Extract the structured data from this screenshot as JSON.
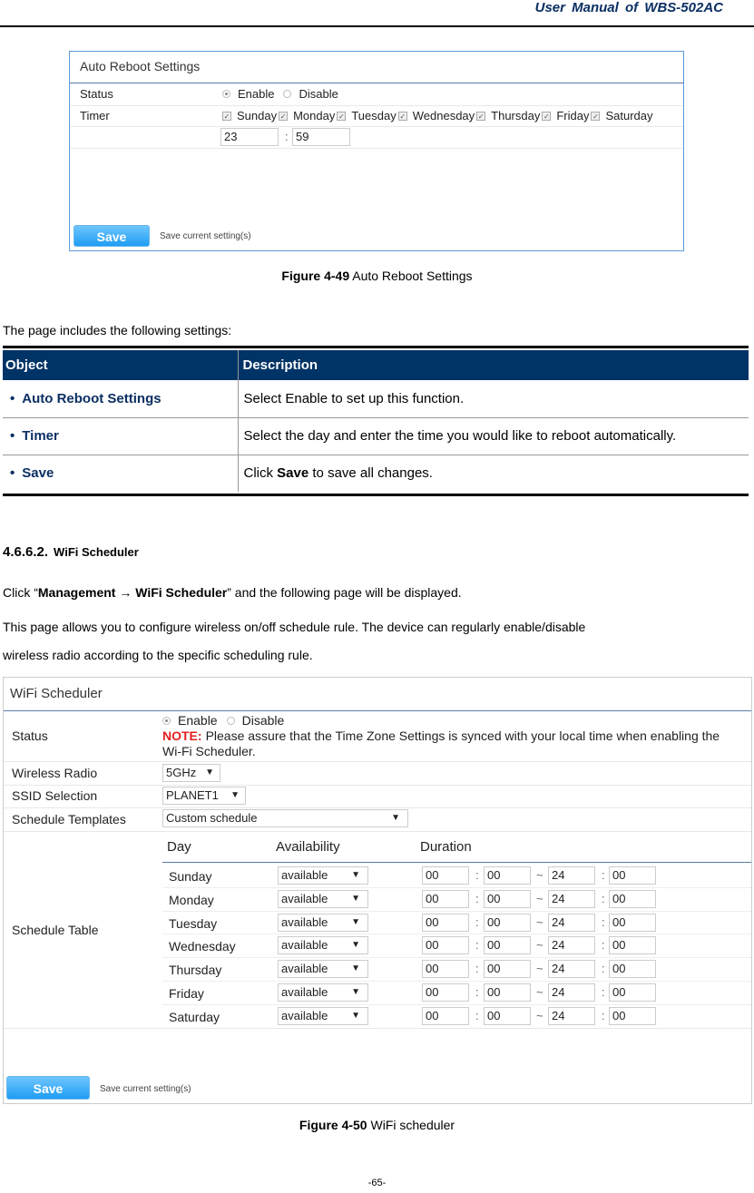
{
  "header": {
    "title": "User  Manual  of  WBS-502AC"
  },
  "auto_reboot": {
    "panel_title": "Auto Reboot Settings",
    "status_label": "Status",
    "status_options": [
      {
        "label": "Enable",
        "selected": true
      },
      {
        "label": "Disable",
        "selected": false
      }
    ],
    "timer_label": "Timer",
    "days": [
      {
        "label": "Sunday",
        "checked": true
      },
      {
        "label": "Monday",
        "checked": true
      },
      {
        "label": "Tuesday",
        "checked": true
      },
      {
        "label": "Wednesday",
        "checked": true
      },
      {
        "label": "Thursday",
        "checked": true
      },
      {
        "label": "Friday",
        "checked": true
      },
      {
        "label": "Saturday",
        "checked": true
      }
    ],
    "hour": "23",
    "minute": "59",
    "time_separator": ":",
    "save_label": "Save",
    "save_hint": "Save current setting(s)"
  },
  "figure_49": {
    "num": "Figure 4-49",
    "text": " Auto Reboot Settings"
  },
  "intro": "The page includes the following settings:",
  "desc_table": {
    "headers": [
      "Object",
      "Description"
    ],
    "rows": [
      {
        "object": "Auto Reboot Settings",
        "desc_pre": "Select Enable to set up this function.",
        "desc_bold": "",
        "desc_post": ""
      },
      {
        "object": "Timer",
        "desc_pre": "Select the day and enter the time you would like to reboot automatically.",
        "desc_bold": "",
        "desc_post": ""
      },
      {
        "object": "Save",
        "desc_pre": "Click ",
        "desc_bold": "Save",
        "desc_post": " to save all changes."
      }
    ],
    "bullet": "•"
  },
  "section": {
    "number": "4.6.6.2.",
    "title": "WiFi Scheduler"
  },
  "click_text": {
    "pre": "Click “",
    "bold": "Management → WiFi Scheduler",
    "post": "” and the following page will be displayed."
  },
  "desc_para_1": "This page allows you to configure wireless on/off schedule rule. The device can regularly enable/disable",
  "desc_para_2": "wireless radio according to the specific scheduling rule.",
  "wifi_scheduler": {
    "panel_title": "WiFi Scheduler",
    "status_label": "Status",
    "status_options": [
      {
        "label": "Enable",
        "selected": true
      },
      {
        "label": "Disable",
        "selected": false
      }
    ],
    "note_label": "NOTE:",
    "note_text_1": "Please assure that the Time Zone Settings is synced with your local time when enabling the",
    "note_text_2": "Wi-Fi Scheduler.",
    "wireless_radio_label": "Wireless Radio",
    "wireless_radio_value": "5GHz",
    "ssid_label": "SSID Selection",
    "ssid_value": "PLANET1",
    "templates_label": "Schedule Templates",
    "templates_value": "Custom schedule",
    "schedule_table_label": "Schedule Table",
    "columns": [
      "Day",
      "Availability",
      "Duration"
    ],
    "arrow": "▼",
    "colon": ":",
    "tilde": "~",
    "rows": [
      {
        "day": "Sunday",
        "availability": "available",
        "start_h": "00",
        "start_m": "00",
        "end_h": "24",
        "end_m": "00"
      },
      {
        "day": "Monday",
        "availability": "available",
        "start_h": "00",
        "start_m": "00",
        "end_h": "24",
        "end_m": "00"
      },
      {
        "day": "Tuesday",
        "availability": "available",
        "start_h": "00",
        "start_m": "00",
        "end_h": "24",
        "end_m": "00"
      },
      {
        "day": "Wednesday",
        "availability": "available",
        "start_h": "00",
        "start_m": "00",
        "end_h": "24",
        "end_m": "00"
      },
      {
        "day": "Thursday",
        "availability": "available",
        "start_h": "00",
        "start_m": "00",
        "end_h": "24",
        "end_m": "00"
      },
      {
        "day": "Friday",
        "availability": "available",
        "start_h": "00",
        "start_m": "00",
        "end_h": "24",
        "end_m": "00"
      },
      {
        "day": "Saturday",
        "availability": "available",
        "start_h": "00",
        "start_m": "00",
        "end_h": "24",
        "end_m": "00"
      }
    ],
    "save_label": "Save",
    "save_hint": "Save current setting(s)"
  },
  "figure_50": {
    "num": "Figure 4-50",
    "text": " WiFi scheduler"
  },
  "page_number": "-65-",
  "colors": {
    "header_blue": "#0b2f63",
    "table_header_bg": "#003366",
    "note_red": "#e02020",
    "save_button": "#1e9df2"
  }
}
